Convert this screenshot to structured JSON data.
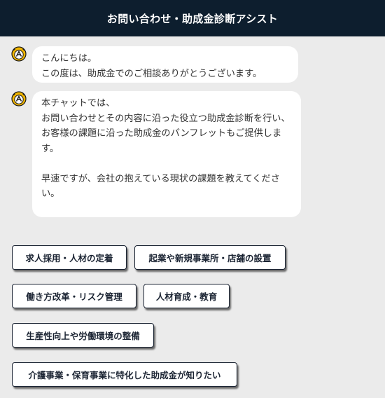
{
  "header": {
    "title": "お問い合わせ・助成金診断アシスト"
  },
  "messages": [
    {
      "avatar_icon": "mascot-icon",
      "text": "こんにちは。\nこの度は、助成金でのご相談ありがとうございます。"
    },
    {
      "avatar_icon": "mascot-icon",
      "text": "本チャットでは、\nお問い合わせとその内容に沿った役立つ助成金診断を行い、\nお客様の課題に沿った助成金のパンフレットもご提供します。\n\n早速ですが、会社の抱えている現状の課題を教えてください。"
    }
  ],
  "choices": [
    "求人採用・人材の定着",
    "起業や新規事業所・店舗の設置",
    "働き方改革・リスク管理",
    "人材育成・教育",
    "生産性向上や労働環境の整備",
    "介護事業・保育事業に特化した助成金が知りたい"
  ],
  "colors": {
    "header_bg": "#0d1e2e",
    "page_bg": "#ebebeb",
    "button_border": "#1b2433"
  }
}
